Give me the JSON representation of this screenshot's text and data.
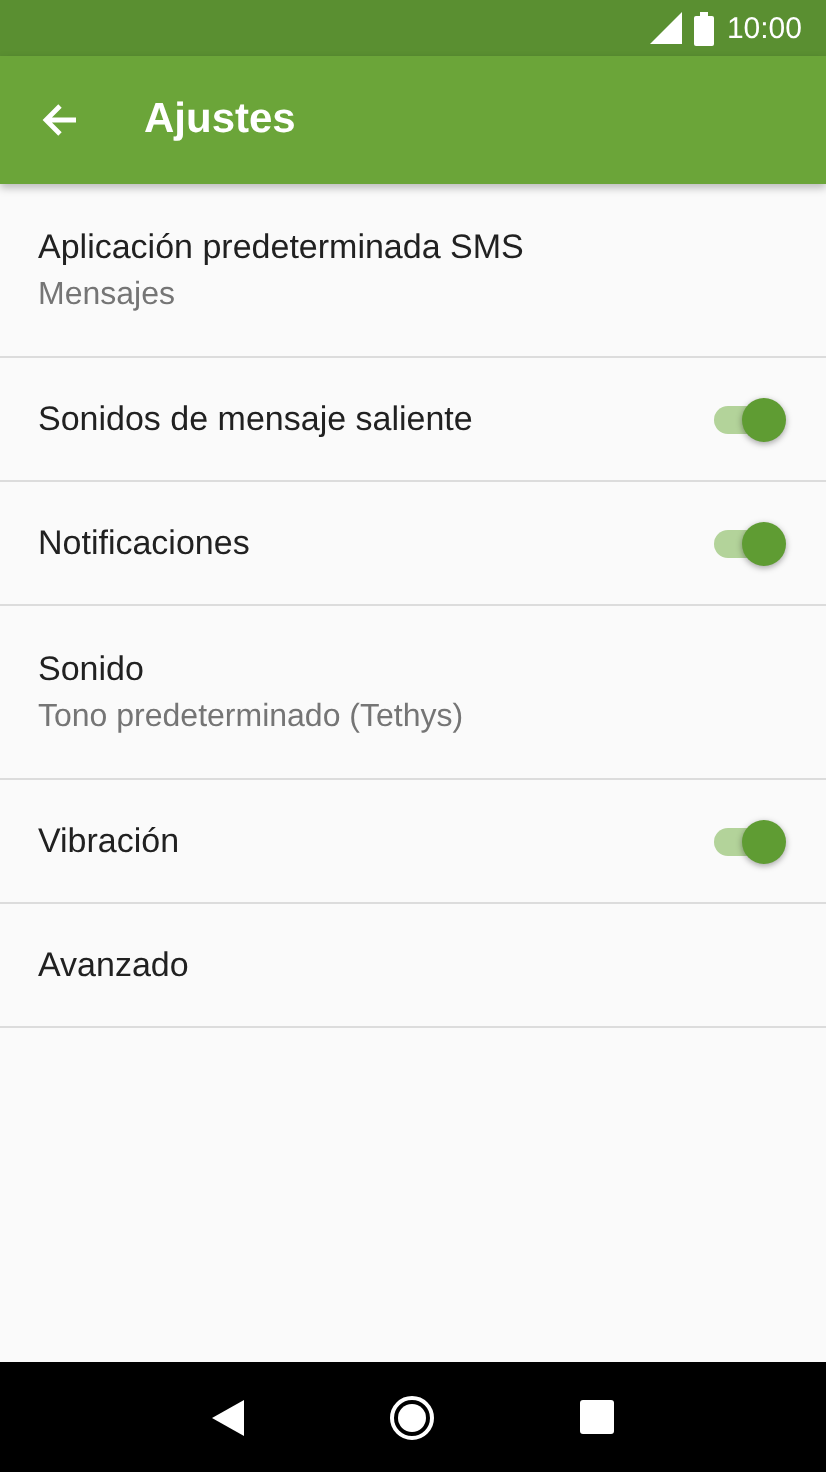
{
  "status_bar": {
    "time": "10:00"
  },
  "app_bar": {
    "title": "Ajustes"
  },
  "settings": [
    {
      "kind": "text",
      "title": "Aplicación predeterminada SMS",
      "summary": "Mensajes"
    },
    {
      "kind": "switch",
      "title": "Sonidos de mensaje saliente",
      "on": true
    },
    {
      "kind": "switch",
      "title": "Notificaciones",
      "on": true
    },
    {
      "kind": "text",
      "title": "Sonido",
      "summary": "Tono predeterminado (Tethys)"
    },
    {
      "kind": "switch",
      "title": "Vibración",
      "on": true
    },
    {
      "kind": "text",
      "title": "Avanzado"
    }
  ]
}
